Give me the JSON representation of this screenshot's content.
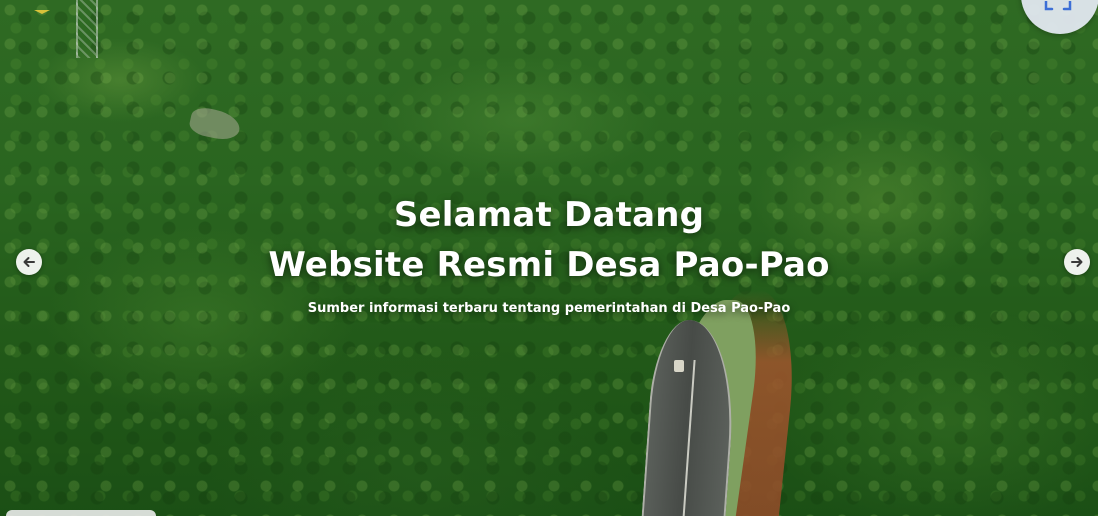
{
  "hero": {
    "title_line1": "Selamat Datang",
    "title_line2": "Website Resmi Desa Pao-Pao",
    "subtitle": "Sumber informasi terbaru tentang pemerintahan di Desa Pao-Pao"
  },
  "carousel": {
    "prev_icon": "arrow-left-icon",
    "next_icon": "arrow-right-icon"
  },
  "icons": {
    "corner": "expand-icon",
    "logo": "logo-icon"
  },
  "colors": {
    "text": "#ffffff",
    "nav_button_bg": "#ffffff",
    "forest": "#2a6520"
  }
}
